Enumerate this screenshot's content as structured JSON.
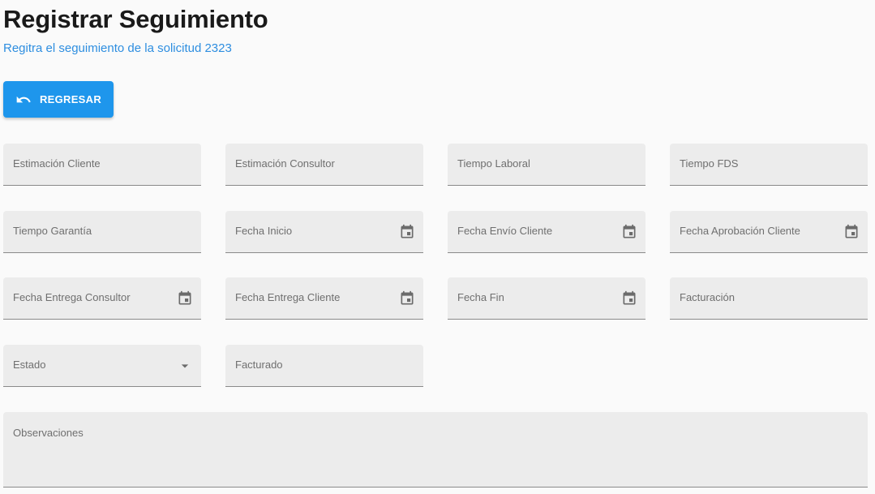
{
  "header": {
    "title": "Registrar Seguimiento",
    "subtitle": "Regitra el seguimiento de la solicitud 2323"
  },
  "actions": {
    "back_label": "REGRESAR",
    "back_icon": "undo-icon"
  },
  "colors": {
    "accent": "#1e96ec",
    "subtitle": "#2e8ee0",
    "field_background": "#ececec"
  },
  "form": {
    "estimacion_cliente": "Estimación Cliente",
    "estimacion_consultor": "Estimación Consultor",
    "tiempo_laboral": "Tiempo Laboral",
    "tiempo_fds": "Tiempo FDS",
    "tiempo_garantia": "Tiempo Garantía",
    "fecha_inicio": "Fecha Inicio",
    "fecha_envio_cliente": "Fecha Envío Cliente",
    "fecha_aprobacion_cliente": "Fecha Aprobación Cliente",
    "fecha_entrega_consultor": "Fecha Entrega Consultor",
    "fecha_entrega_cliente": "Fecha Entrega Cliente",
    "fecha_fin": "Fecha Fin",
    "facturacion": "Facturación",
    "estado": "Estado",
    "facturado": "Facturado",
    "observaciones": "Observaciones",
    "date_icon": "calendar-icon",
    "select_icon": "dropdown-arrow-icon"
  }
}
